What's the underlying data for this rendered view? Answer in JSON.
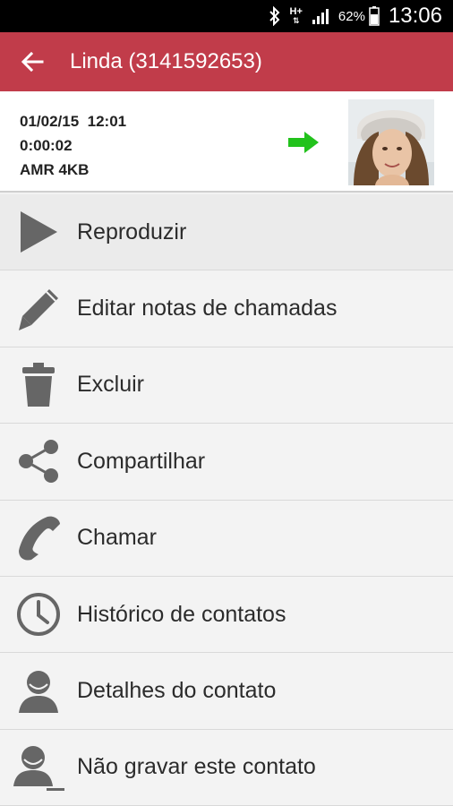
{
  "status_bar": {
    "network": "H+",
    "battery": "62%",
    "time": "13:06"
  },
  "app_bar": {
    "title": "Linda (3141592653)",
    "color": "#c13c4a"
  },
  "recording": {
    "datetime": "01/02/15  12:01",
    "duration": "0:00:02",
    "format": "AMR 4KB",
    "direction": "outgoing",
    "arrow_color": "#22c21c"
  },
  "menu": [
    {
      "label": "Reproduzir",
      "icon": "play-icon"
    },
    {
      "label": "Editar notas de chamadas",
      "icon": "pencil-icon"
    },
    {
      "label": "Excluir",
      "icon": "trash-icon"
    },
    {
      "label": "Compartilhar",
      "icon": "share-icon"
    },
    {
      "label": "Chamar",
      "icon": "phone-icon"
    },
    {
      "label": "Histórico de contatos",
      "icon": "clock-icon"
    },
    {
      "label": "Detalhes do contato",
      "icon": "person-icon"
    },
    {
      "label": "Não gravar este contato",
      "icon": "person-blocked-icon"
    }
  ]
}
